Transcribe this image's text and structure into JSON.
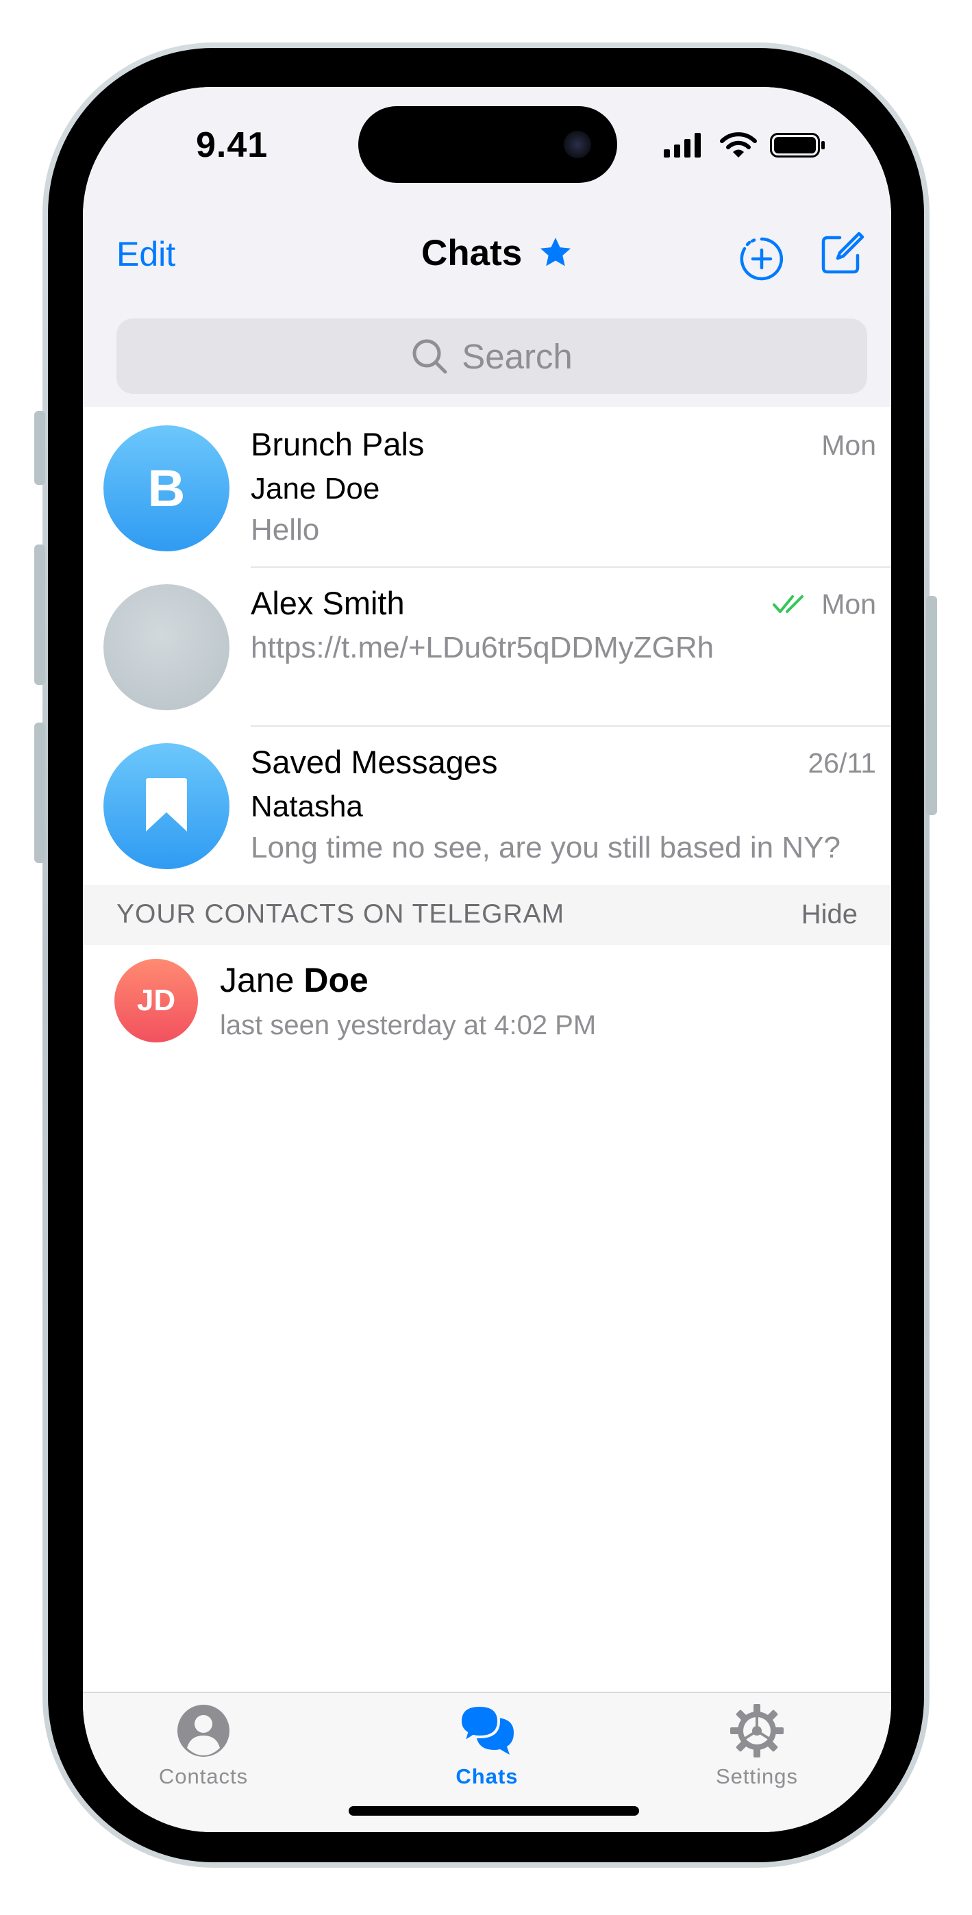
{
  "status_bar": {
    "time": "9.41"
  },
  "nav": {
    "edit_label": "Edit",
    "title": "Chats"
  },
  "search": {
    "placeholder": "Search"
  },
  "chats": [
    {
      "name": "Brunch Pals",
      "avatar_letter": "B",
      "date": "Mon",
      "sender": "Jane Doe",
      "preview": "Hello"
    },
    {
      "name": "Alex Smith",
      "date": "Mon",
      "preview": "https://t.me/+LDu6tr5qDDMyZGRh",
      "read_status": "read"
    },
    {
      "name": "Saved Messages",
      "date": "26/11",
      "sender": "Natasha",
      "preview": "Long time no see, are you still based in NY?"
    }
  ],
  "contacts_section": {
    "title": "YOUR CONTACTS ON TELEGRAM",
    "hide_label": "Hide",
    "contacts": [
      {
        "initials": "JD",
        "first_name": "Jane",
        "last_name": "Doe",
        "status": "last seen yesterday at 4:02 PM"
      }
    ]
  },
  "tabs": [
    {
      "label": "Contacts",
      "icon": "person-circle-icon",
      "active": false
    },
    {
      "label": "Chats",
      "icon": "chat-bubbles-icon",
      "active": true
    },
    {
      "label": "Settings",
      "icon": "gear-icon",
      "active": false
    }
  ],
  "colors": {
    "accent": "#007aff",
    "read_check": "#34c759",
    "contact_avatar": "#f2515e",
    "chat_avatar": "#2f9bf2"
  }
}
